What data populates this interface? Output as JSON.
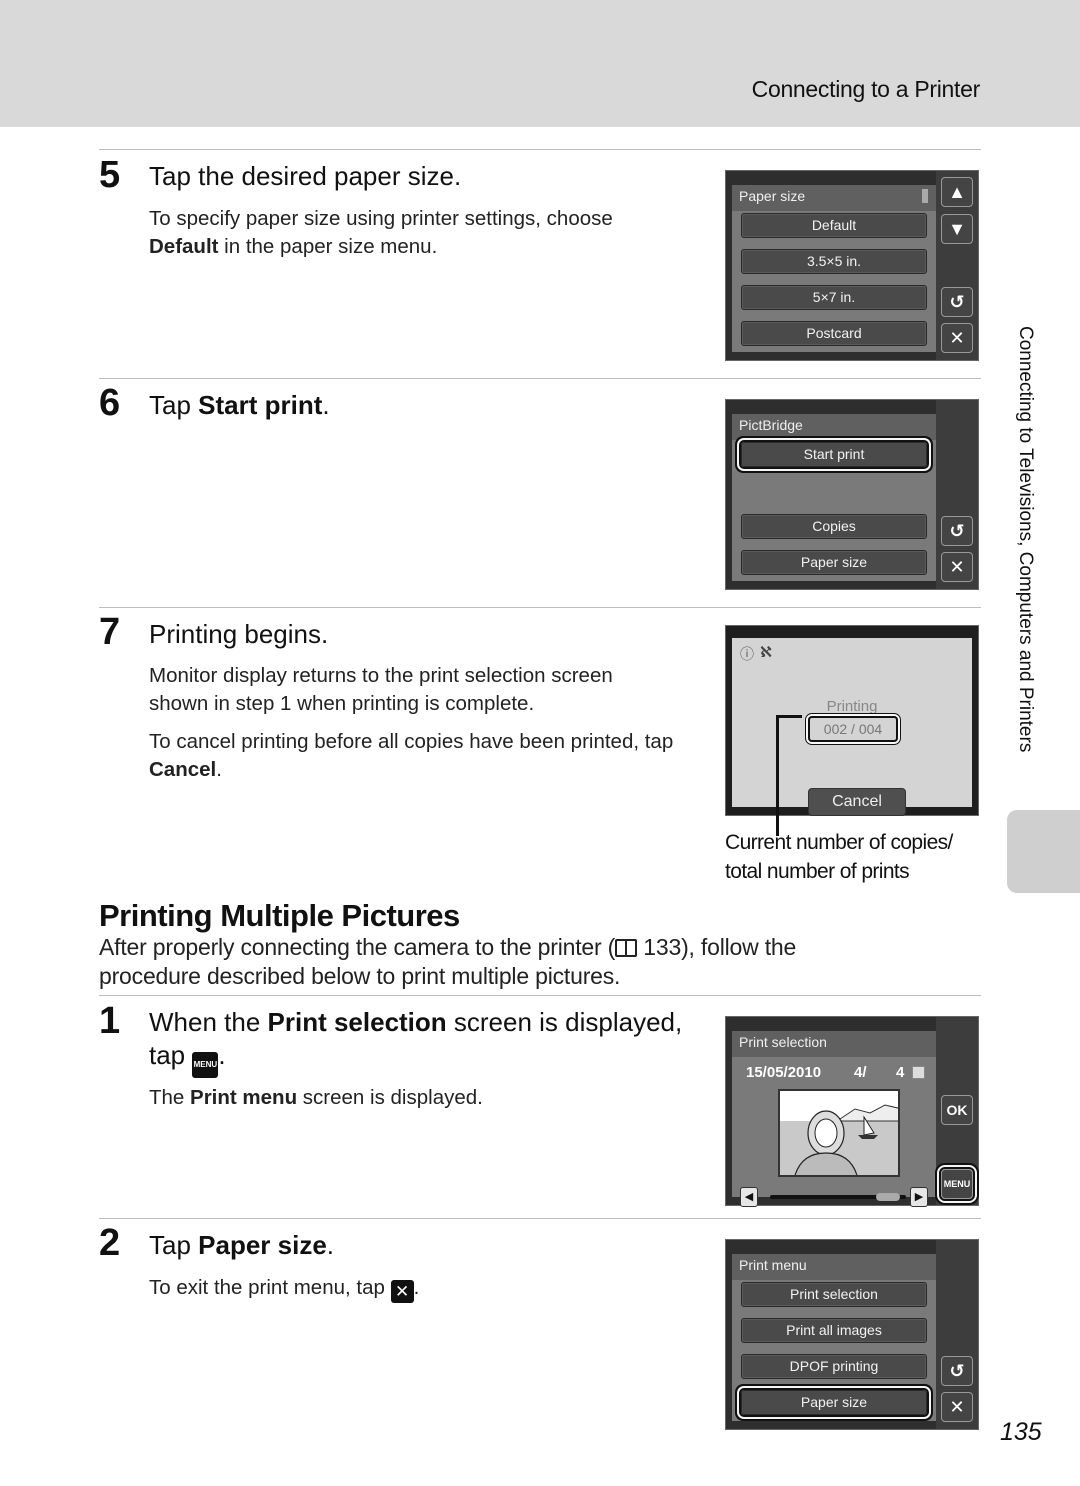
{
  "header": {
    "section_title": "Connecting to a Printer"
  },
  "side_tab": {
    "label": "Connecting to Televisions, Computers and Printers"
  },
  "page_number": "135",
  "steps_part1": [
    {
      "number": "5",
      "heading": "Tap the desired paper size.",
      "body_line1": "To specify paper size using printer settings, choose",
      "body_bold": "Default",
      "body_line2_rest": " in the paper size menu.",
      "screen": {
        "title": "Paper size",
        "options": [
          "Default",
          "3.5×5 in.",
          "5×7 in.",
          "Postcard"
        ],
        "side_buttons": [
          "up-arrow",
          "down-arrow",
          "back",
          "close"
        ]
      }
    },
    {
      "number": "6",
      "heading_prefix": "Tap ",
      "heading_bold": "Start print",
      "heading_suffix": ".",
      "screen": {
        "title": "PictBridge",
        "options": [
          "Start print",
          "Copies",
          "Paper size"
        ],
        "selected": "Start print"
      }
    },
    {
      "number": "7",
      "heading": "Printing begins.",
      "body_p1_line1": "Monitor display returns to the print selection screen",
      "body_p1_line2": "shown in step 1 when printing is complete.",
      "body_p2_line1": "To cancel printing before all copies have been printed, tap",
      "body_p2_bold": "Cancel",
      "body_p2_end": ".",
      "screen": {
        "status": "Printing",
        "counter": "002  /  004",
        "cancel_label": "Cancel"
      },
      "callout_line1": "Current number of copies/",
      "callout_line2": "total number of prints"
    }
  ],
  "section2": {
    "title": "Printing Multiple Pictures",
    "intro_line1_a": "After properly connecting the camera to the printer (",
    "intro_ref_icon": "book-icon",
    "intro_line1_b": " 133), follow the",
    "intro_line2": "procedure described below to print multiple pictures."
  },
  "steps_part2": [
    {
      "number": "1",
      "heading_a": "When the ",
      "heading_bold": "Print selection",
      "heading_b": " screen is displayed,",
      "heading_line2": "tap ",
      "heading_icon": "MENU",
      "body_a": "The ",
      "body_bold": "Print menu",
      "body_b": " screen is displayed.",
      "screen": {
        "title": "Print selection",
        "date": "15/05/2010",
        "index": "4/",
        "total": "4",
        "ok_label": "OK",
        "menu_label": "MENU"
      }
    },
    {
      "number": "2",
      "heading_prefix": "Tap ",
      "heading_bold": "Paper size",
      "heading_suffix": ".",
      "body": "To exit the print menu, tap ",
      "body_icon": "✕",
      "body_end": ".",
      "screen": {
        "title": "Print menu",
        "options": [
          "Print selection",
          "Print all images",
          "DPOF printing",
          "Paper size"
        ],
        "selected": "Paper size"
      }
    }
  ]
}
